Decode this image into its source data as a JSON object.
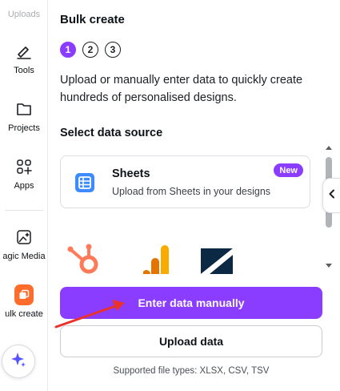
{
  "rail": {
    "items": [
      {
        "label": "Uploads",
        "icon": "upload-icon"
      },
      {
        "label": "Tools",
        "icon": "pen-icon"
      },
      {
        "label": "Projects",
        "icon": "folder-icon"
      },
      {
        "label": "Apps",
        "icon": "apps-grid-icon"
      },
      {
        "label": "agic Media",
        "icon": "magic-media-icon"
      },
      {
        "label": "ulk create",
        "icon": "bulk-create-icon"
      }
    ],
    "magic_button_icon": "sparkle-icon"
  },
  "panel": {
    "title": "Bulk create",
    "steps": [
      "1",
      "2",
      "3"
    ],
    "active_step": 1,
    "description": "Upload or manually enter data to quickly create hundreds of personalised designs.",
    "section_title": "Select data source",
    "source_card": {
      "title": "Sheets",
      "subtitle": "Upload from Sheets in your designs",
      "badge": "New",
      "icon": "sheets-icon"
    },
    "more_sources_icons": [
      "hubspot-icon",
      "google-analytics-icon",
      "smartsheet-icon"
    ],
    "primary_button": "Enter data manually",
    "secondary_button": "Upload data",
    "file_types": "Supported file types: XLSX, CSV, TSV"
  },
  "colors": {
    "accent": "#8b3dff",
    "bulk_create_tile": "#ff6d2d",
    "annotation_arrow": "#e8322b"
  }
}
